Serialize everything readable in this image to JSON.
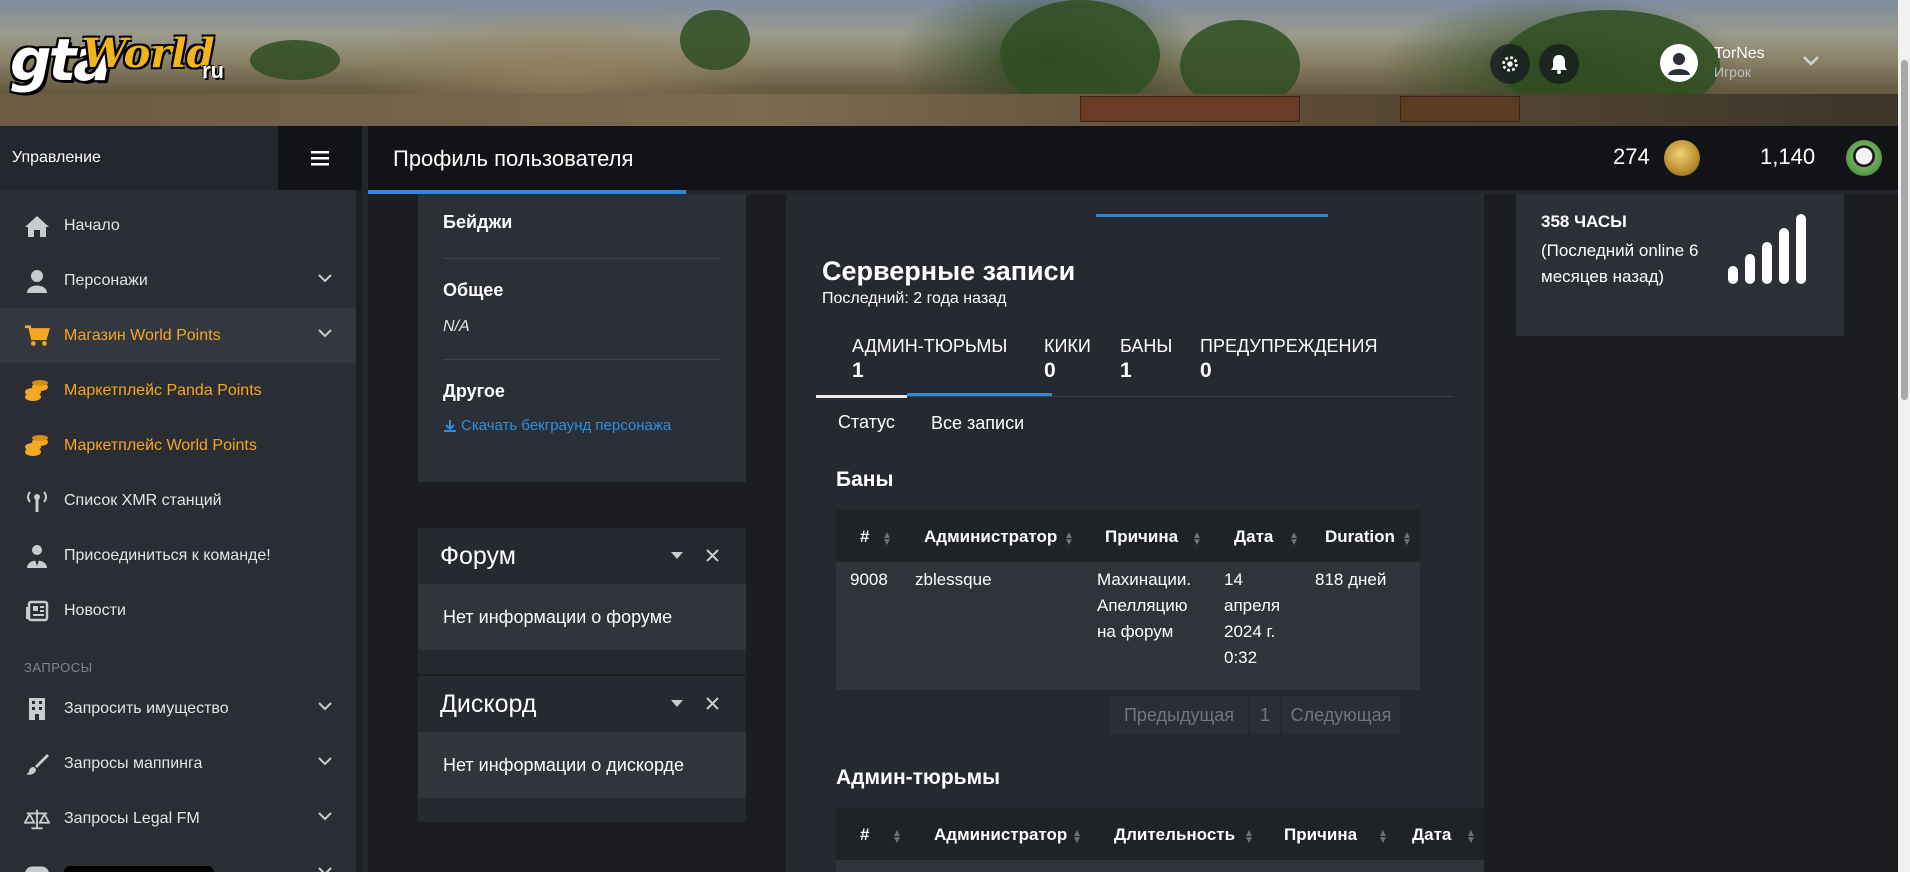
{
  "logo": {
    "gta": "gta",
    "world": "World",
    "ru": "ru"
  },
  "header": {
    "user_name": "TorNes",
    "user_role": "Игрок"
  },
  "sidebar": {
    "title": "Управление",
    "items": [
      {
        "label": "Начало",
        "icon": "home-icon"
      },
      {
        "label": "Персонажи",
        "icon": "user-icon"
      },
      {
        "label": "Магазин World Points",
        "icon": "cart-icon"
      },
      {
        "label": "Маркетплейс Panda Points",
        "icon": "coins-icon"
      },
      {
        "label": "Маркетплейс World Points",
        "icon": "coins-icon"
      },
      {
        "label": "Список XMR станций",
        "icon": "antenna-icon"
      },
      {
        "label": "Присоединиться к команде!",
        "icon": "user-tie-icon"
      },
      {
        "label": "Новости",
        "icon": "newspaper-icon"
      }
    ],
    "section": "ЗАПРОСЫ",
    "requests": [
      {
        "label": "Запросить имущество",
        "icon": "building-icon"
      },
      {
        "label": "Запросы маппинга",
        "icon": "brush-icon"
      },
      {
        "label": "Запросы Legal FM",
        "icon": "scales-icon"
      }
    ]
  },
  "topbar": {
    "title": "Профиль пользователя",
    "points_a": "274",
    "points_b": "1,140"
  },
  "left_card": {
    "badges": "Бейджи",
    "general": "Общее",
    "general_value": "N/A",
    "other": "Другое",
    "download_link": "Скачать бекграунд персонажа"
  },
  "forum": {
    "title": "Форум",
    "body": "Нет информации о форуме"
  },
  "discord": {
    "title": "Дискорд",
    "body": "Нет информации о дискорде"
  },
  "records": {
    "title": "Серверные записи",
    "last": "Последний: 2 года назад",
    "stats": [
      {
        "label": "АДМИН-ТЮРЬМЫ",
        "value": "1"
      },
      {
        "label": "КИКИ",
        "value": "0"
      },
      {
        "label": "БАНЫ",
        "value": "1"
      },
      {
        "label": "ПРЕДУПРЕЖДЕНИЯ",
        "value": "0"
      }
    ],
    "tabs": [
      "Статус",
      "Все записи"
    ]
  },
  "bans": {
    "title": "Баны",
    "columns": [
      "#",
      "Администратор",
      "Причина",
      "Дата",
      "Duration"
    ],
    "row": {
      "id": "9008",
      "admin": "zblessque",
      "reason": [
        "Махинации.",
        "Апелляцию",
        "на форум"
      ],
      "date": [
        "14",
        "апреля",
        "2024 г.",
        "0:32"
      ],
      "duration": "818 дней"
    },
    "pager": {
      "prev": "Предыдущая",
      "page": "1",
      "next": "Следующая"
    }
  },
  "jails": {
    "title": "Админ-тюрьмы",
    "columns": [
      "#",
      "Администратор",
      "Длительность",
      "Причина",
      "Дата"
    ]
  },
  "hours_card": {
    "hours": "358 ЧАСЫ",
    "line1": "(Последний online 6",
    "line2": "месяцев назад)"
  },
  "colors": {
    "accent": "#2e86de",
    "orange": "#f5a623",
    "sidebar": "#2a2d33"
  }
}
